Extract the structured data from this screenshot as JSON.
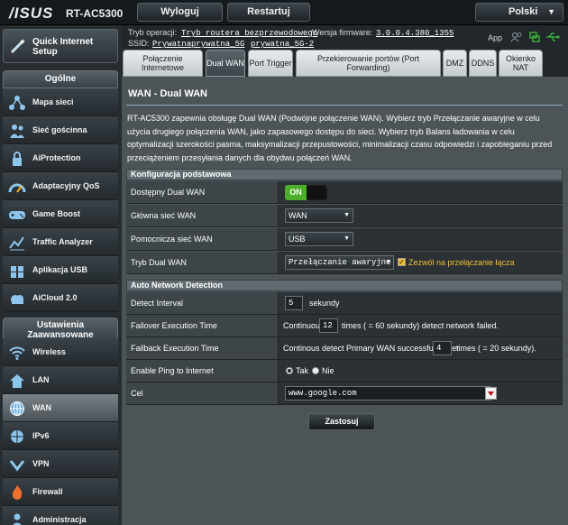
{
  "header": {
    "logo": "/ISUS",
    "model": "RT-AC5300",
    "logout": "Wyloguj",
    "restart": "Restartuj",
    "language": "Polski"
  },
  "info": {
    "mode_label": "Tryb operacji:",
    "mode_value": "Tryb routera bezprzewodowego",
    "fw_label": "Wersja firmware:",
    "fw_value": "3.0.0.4.380_1355",
    "ssid_label": "SSID:",
    "ssid1": "Prywatna",
    "ssid2": "prywatna_5G",
    "ssid3": "prywatna_5G-2",
    "app": "App"
  },
  "sidebar": {
    "quick": "Quick Internet Setup",
    "general_title": "Ogólne",
    "general": [
      "Mapa sieci",
      "Sieć gościnna",
      "AiProtection",
      "Adaptacyjny QoS",
      "Game Boost",
      "Traffic Analyzer",
      "Aplikacja USB",
      "AiCloud 2.0"
    ],
    "advanced_title": "Ustawienia Zaawansowane",
    "advanced": [
      "Wireless",
      "LAN",
      "WAN",
      "IPv6",
      "VPN",
      "Firewall",
      "Administracja"
    ]
  },
  "tabs": [
    "Połączenie Internetowe",
    "Dual WAN",
    "Port Trigger",
    "Przekierowanie portów (Port Forwarding)",
    "DMZ",
    "DDNS",
    "Okienko NAT"
  ],
  "page": {
    "title": "WAN - Dual WAN",
    "description": "RT-AC5300 zapewnia obsługę Dual WAN (Podwójne połączenie WAN). Wybierz tryb Przełączanie awaryjne w celu użycia drugiego połączenia WAN, jako zapasowego dostępu do sieci. Wybierz tryb Balans ładowania w celu optymalizacji szerokości pasma, maksymalizacji przepustowości, minimalizacji czasu odpowiedzi i zapobieganiu przed przeciążeniem przesyłania danych dla obydwu połączeń WAN.",
    "basic_title": "Konfiguracja podstawowa",
    "enable_label": "Dostępny Dual WAN",
    "enable_value": "ON",
    "primary_label": "Główna sieć WAN",
    "primary_value": "WAN",
    "secondary_label": "Pomocnicza sieć WAN",
    "secondary_value": "USB",
    "mode_label": "Tryb Dual WAN",
    "mode_value": "Przełączanie awaryjne",
    "allow_label": "Zezwól na przełączanie łącza",
    "detect_title": "Auto Network Detection",
    "interval_label": "Detect Interval",
    "interval_value": "5",
    "interval_unit": "sekundy",
    "failover_label": "Failover Execution Time",
    "failover_pre": "Continuous",
    "failover_value": "12",
    "failover_post": "times ( = 60  sekundy) detect network failed.",
    "failback_label": "Failback Execution Time",
    "failback_pre": "Continous detect Primary WAN successfully over",
    "failback_value": "4",
    "failback_post": "times ( = 20  sekundy).",
    "ping_label": "Enable Ping to Internet",
    "ping_yes": "Tak",
    "ping_no": "Nie",
    "target_label": "Cel",
    "target_value": "www.google.com",
    "apply": "Zastosuj"
  },
  "colors": {
    "accent_green": "#4caf2a",
    "usb_green": "#3fbf3f",
    "icon_blue": "#6fb0e0"
  }
}
